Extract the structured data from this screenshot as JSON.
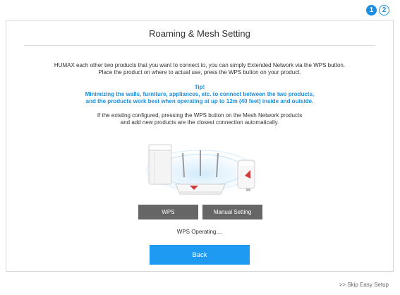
{
  "stepper": {
    "steps": [
      {
        "number": "1",
        "state": "active"
      },
      {
        "number": "2",
        "state": "inactive"
      }
    ]
  },
  "panel": {
    "title": "Roaming & Mesh Setting",
    "intro_line1": "HUMAX each other two products that you want to connect to, you can simply Extended Network via the WPS button.",
    "intro_line2": "Place the product on where to actual use, press the WPS button on your product.",
    "tip_heading": "Tip!",
    "tip_line1": "Minimizing the walls, furniture, appliances, etc. to connect between the two products,",
    "tip_line2": "and the products work best when operating at up to 12m (40 feet) inside and outside.",
    "info_line1": "If the existing configured, pressing the WPS button on the Mesh Network products",
    "info_line2": "and add new products are the closest connection automatically.",
    "wps_button_label": "WPS",
    "manual_button_label": "Manual Setting",
    "status_text": "WPS Operating....",
    "back_button_label": "Back"
  },
  "skip_link": ">> Skip Easy Setup",
  "colors": {
    "accent": "#1a8fe3",
    "back_button": "#1e9af2",
    "gray_button": "#666666",
    "panel_border": "#d7d7d7"
  },
  "icons": {
    "illustration": "mesh-devices-illustration",
    "extender": "wall-extender-icon",
    "router": "router-icon",
    "tower": "mesh-tower-icon"
  }
}
